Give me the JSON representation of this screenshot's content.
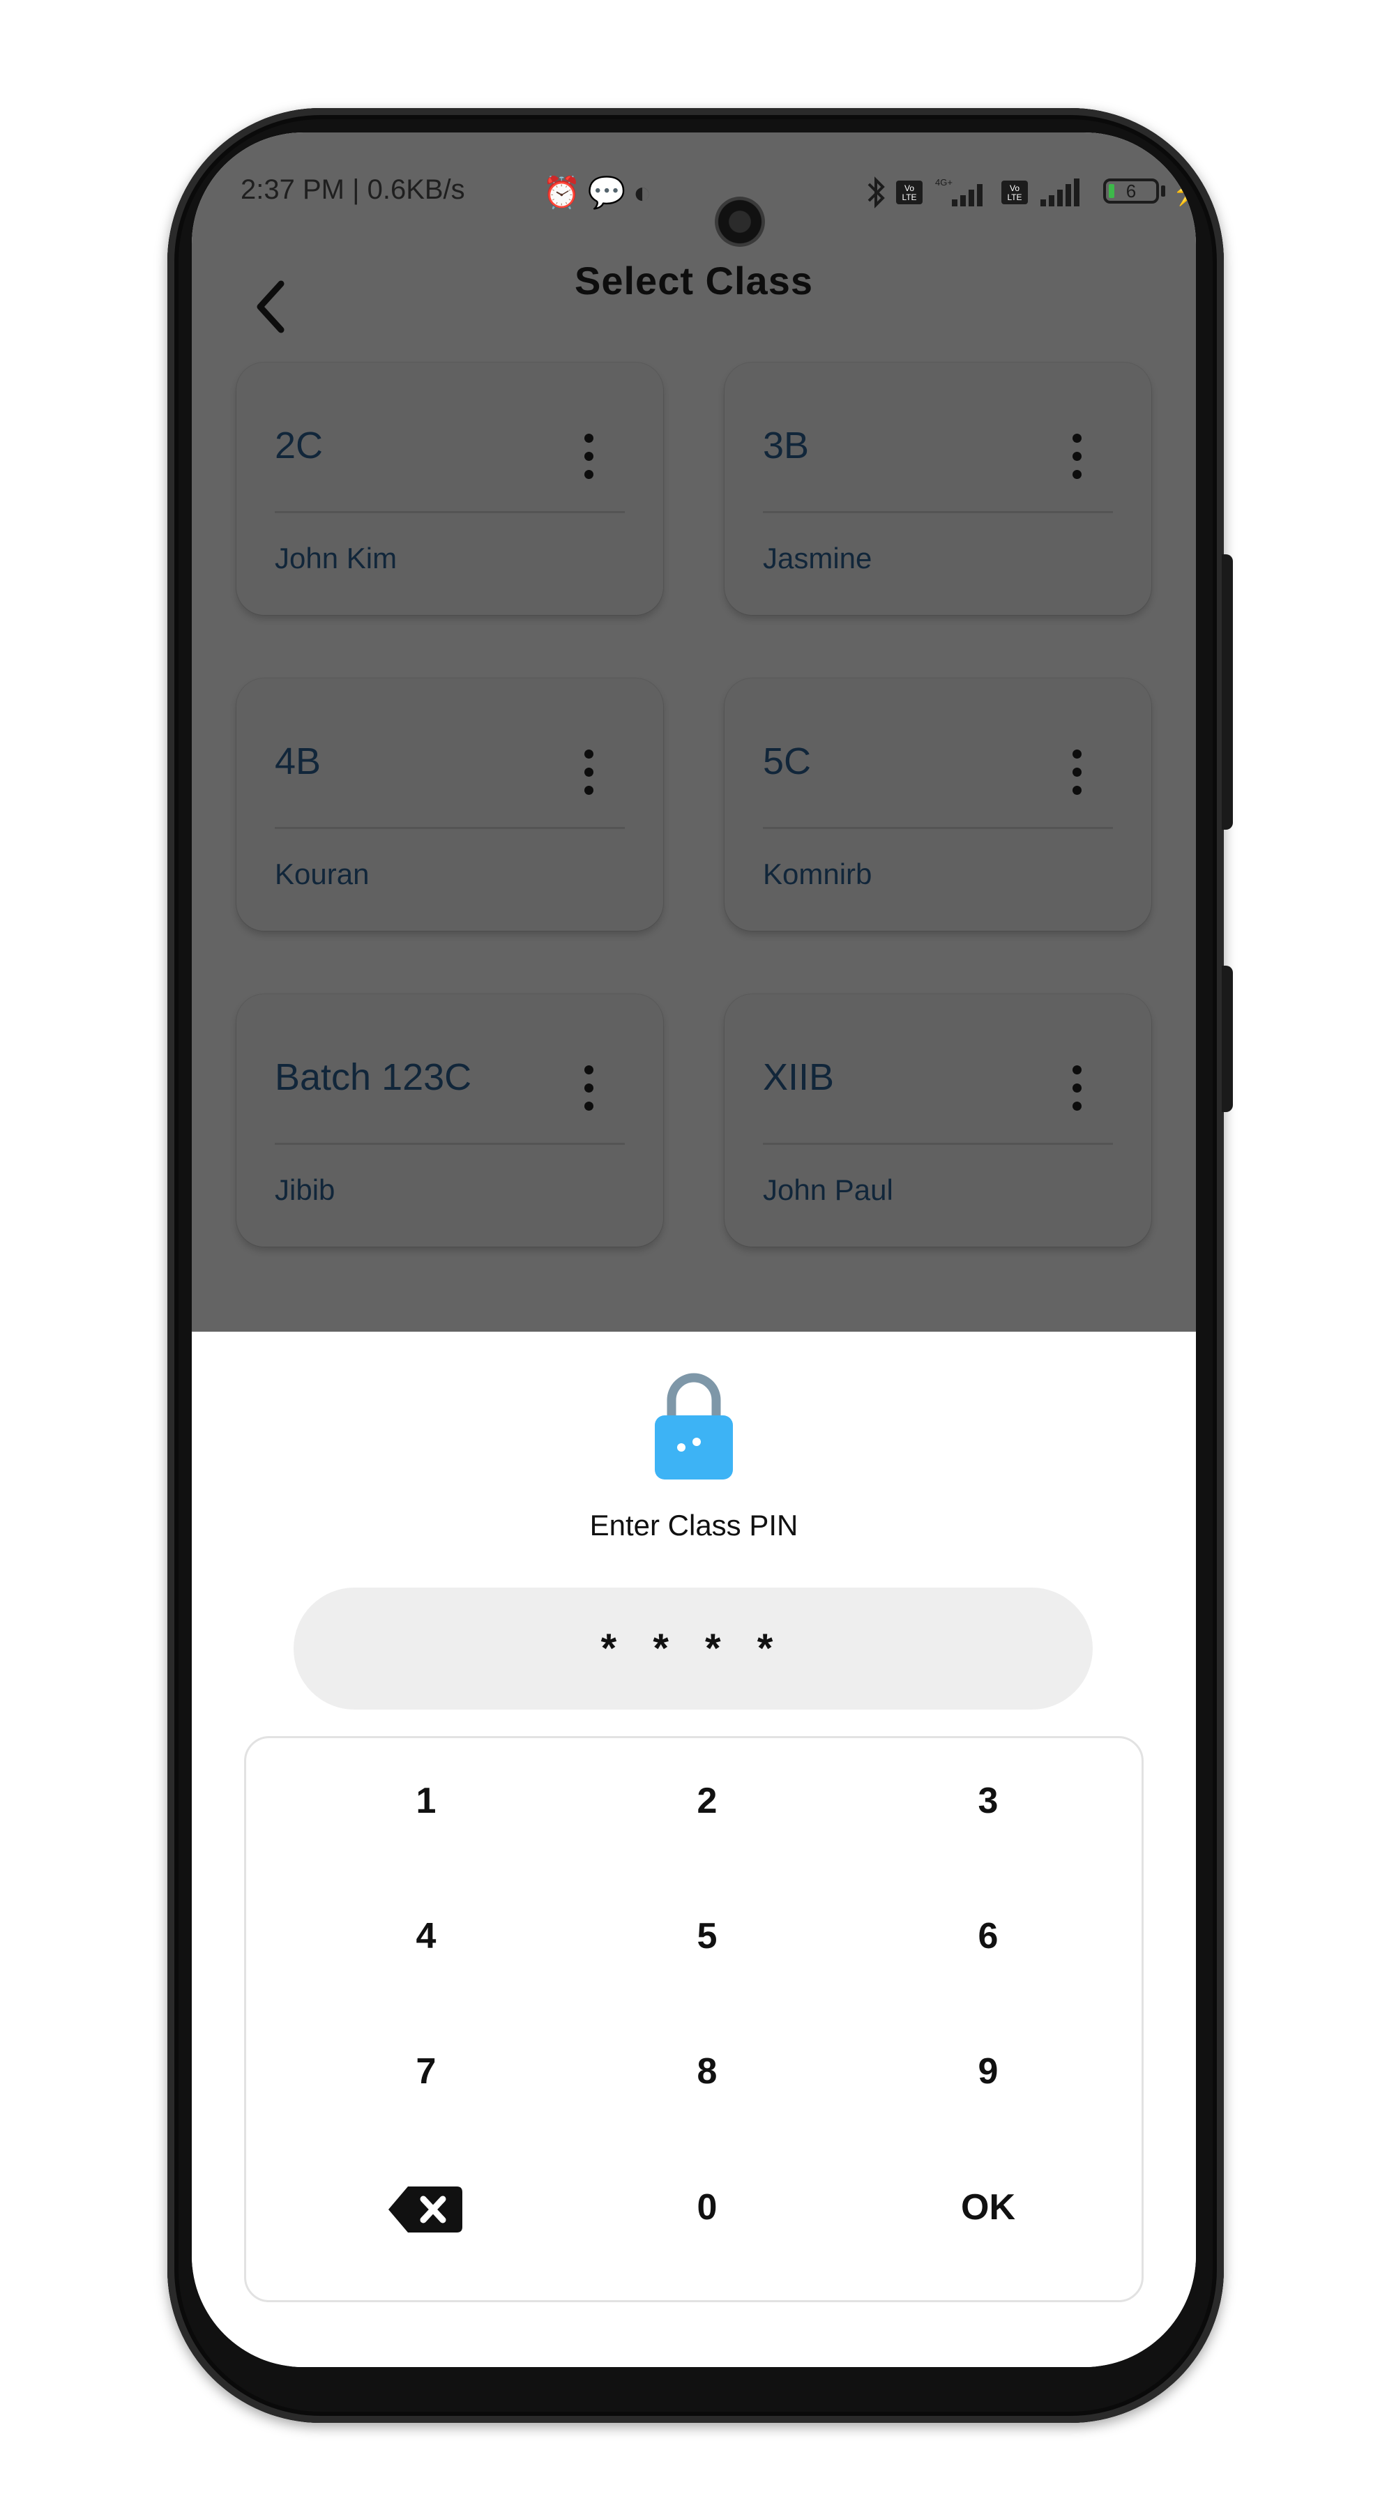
{
  "status_bar": {
    "time": "2:37 PM | 0.6KB/s",
    "left_icons": [
      "alarm-icon",
      "chat-icon",
      "app-icon"
    ],
    "right_icons": [
      "bluetooth-icon",
      "volte-icon",
      "signal-4g-icon",
      "volte-icon",
      "signal-icon"
    ],
    "volte": "Vo LTE",
    "network": "4G+",
    "battery": "6",
    "charging_icon": "bolt-icon"
  },
  "header": {
    "title": "Select Class",
    "back_icon": "chevron-left-icon"
  },
  "classes": [
    {
      "name": "2C",
      "teacher": "John Kim"
    },
    {
      "name": "3B",
      "teacher": "Jasmine"
    },
    {
      "name": "4B",
      "teacher": "Kouran"
    },
    {
      "name": "5C",
      "teacher": "Komnirb"
    },
    {
      "name": "Batch 123C",
      "teacher": "Jibib"
    },
    {
      "name": "XIIB",
      "teacher": "John Paul"
    }
  ],
  "pin_sheet": {
    "icon": "lock-icon",
    "prompt": "Enter Class PIN",
    "pin_display": "****",
    "keys": [
      "1",
      "2",
      "3",
      "4",
      "5",
      "6",
      "7",
      "8",
      "9",
      "⌫",
      "0",
      "OK"
    ],
    "delete_icon": "backspace-icon",
    "ok_label": "OK"
  },
  "colors": {
    "overlay": "#646464",
    "card_text": "#11263a",
    "lock_body": "#3db3f5",
    "lock_shackle": "#7e97a8",
    "pin_field": "#eeeeee"
  }
}
